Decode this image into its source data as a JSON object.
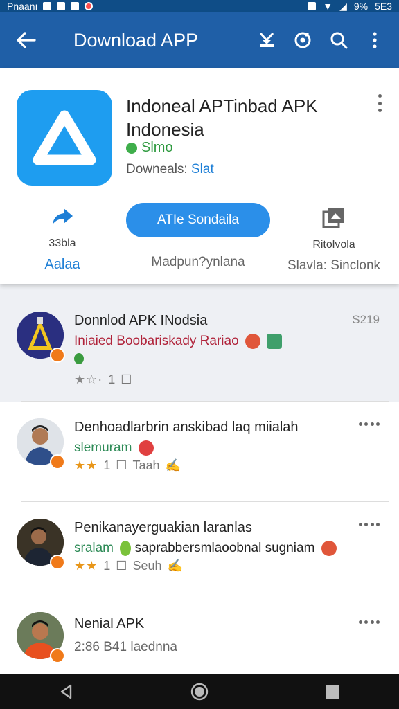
{
  "status_bar": {
    "left_text": "Pnaanı",
    "right_text": "9%",
    "clock": "5E3"
  },
  "appbar": {
    "title": "Download APP",
    "icons": [
      "back-arrow-icon",
      "bookmark-icon",
      "compass-icon",
      "search-icon",
      "more-vert-icon"
    ]
  },
  "app": {
    "name": "Indoneal APTinbad APK Indonesia",
    "developer": "Slmo",
    "downloads_label": "Downeals:",
    "downloads_value": "Slat",
    "share": {
      "label1": "33bla",
      "label2": "Aalaa"
    },
    "install_button": "ATIe Sondaila",
    "install_caption": "Madpun?ynlana",
    "similar": {
      "label1": "Ritolvola",
      "label2": "Slavla: Sinclonk"
    }
  },
  "list": [
    {
      "title": "Donnlod APK INodsia",
      "subtitle": "Iniaied Boobariskady Rariao",
      "subtitle_color": "#b0233a",
      "meta_left": "1",
      "meta_right": "",
      "stars": 1,
      "right_text": "S219",
      "avatar": "app-logo"
    },
    {
      "title": "Denhoadlarbrin anskibad laq miialah",
      "subtitle": "slemuram",
      "subtitle_color": "#2e8b57",
      "meta_left": "1",
      "meta_right": "Taah",
      "stars": 2,
      "right_text": "",
      "avatar": "person-1"
    },
    {
      "title": "Penikanayerguakian laranlas",
      "subtitle": "sralam",
      "subtitle2": "saprabbersmlaoobnal sugniam",
      "subtitle_color": "#2e8b57",
      "meta_left": "1",
      "meta_right": "Seuh",
      "stars": 2,
      "right_text": "",
      "avatar": "person-2"
    },
    {
      "title": "Nenial APK",
      "subtitle": "2:86 B41 laednna",
      "subtitle_color": "#666666",
      "meta_left": "",
      "meta_right": "",
      "stars": 0,
      "right_text": "",
      "avatar": "person-3"
    }
  ],
  "colors": {
    "primary": "#1f5fa7",
    "accent": "#2b8fe9",
    "app_icon": "#1e9df0",
    "star": "#e8961a"
  }
}
